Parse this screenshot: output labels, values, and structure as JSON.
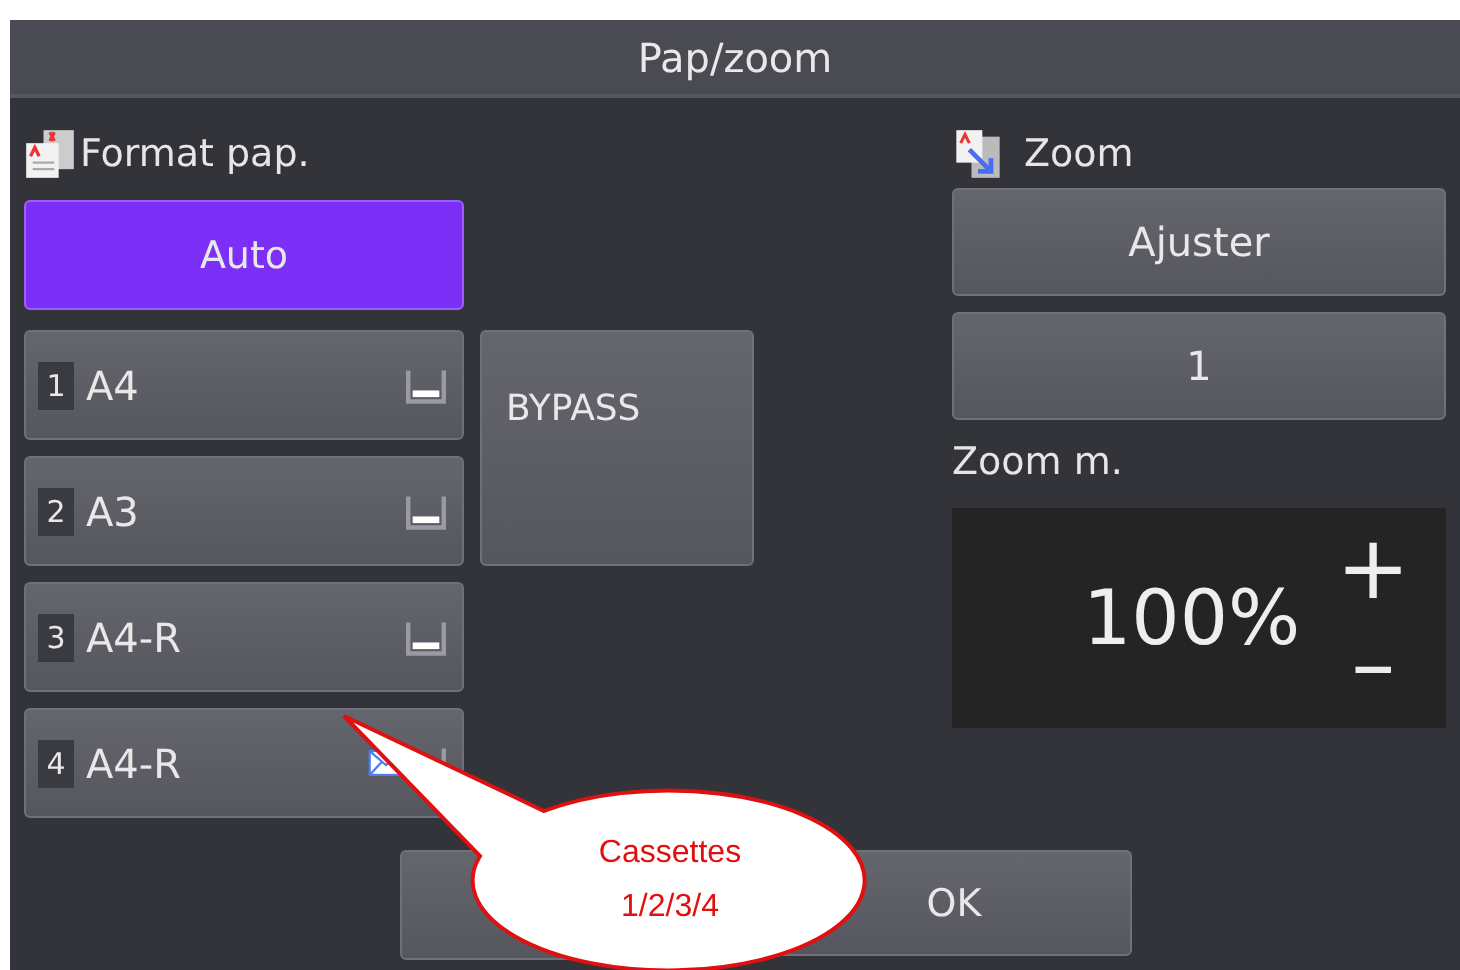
{
  "window": {
    "title": "Pap/zoom"
  },
  "paper_format": {
    "heading": "Format pap.",
    "auto": {
      "label": "Auto",
      "selected": true
    },
    "trays": [
      {
        "number": "1",
        "size": "A4",
        "selected": false,
        "envelope": false
      },
      {
        "number": "2",
        "size": "A3",
        "selected": false,
        "envelope": false
      },
      {
        "number": "3",
        "size": "A4-R",
        "selected": false,
        "envelope": false
      },
      {
        "number": "4",
        "size": "A4-R",
        "selected": false,
        "envelope": true
      }
    ],
    "bypass": {
      "label": "BYPASS",
      "selected": false
    }
  },
  "zoom": {
    "heading": "Zoom",
    "buttons": [
      {
        "label": "Ajuster",
        "selected": false
      },
      {
        "label": "1",
        "selected": false
      }
    ],
    "manual_label": "Zoom m.",
    "value": "100%",
    "plus": "+",
    "minus": "–"
  },
  "footer_buttons": [
    {
      "label": "OK"
    }
  ],
  "callout": {
    "lines": [
      "Cassettes",
      "1/2/3/4"
    ]
  }
}
